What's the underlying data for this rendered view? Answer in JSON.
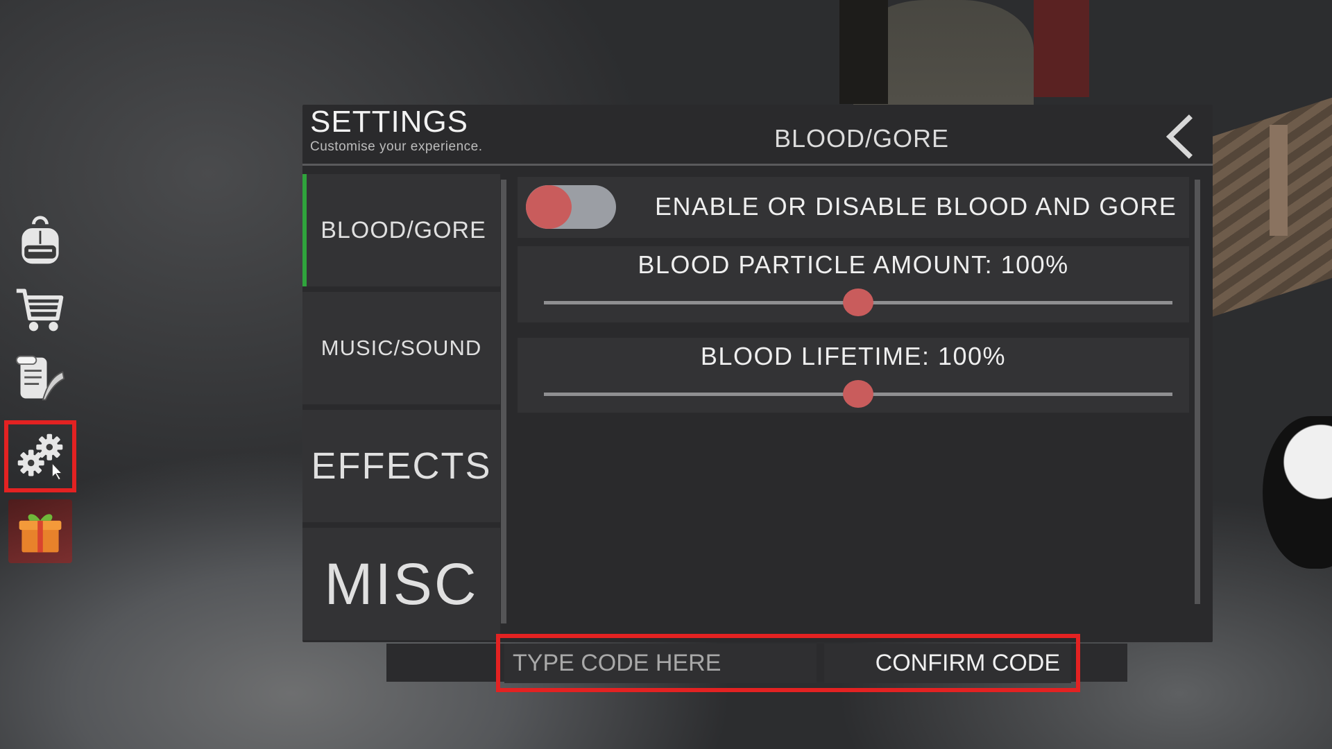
{
  "settings": {
    "title": "SETTINGS",
    "subtitle": "Customise your experience.",
    "current_section": "BLOOD/GORE",
    "back_icon": "chevron-left-icon"
  },
  "toolbar": {
    "items": [
      {
        "name": "backpack",
        "icon": "backpack-icon"
      },
      {
        "name": "shop",
        "icon": "shopping-cart-icon"
      },
      {
        "name": "quests",
        "icon": "scroll-quill-icon"
      },
      {
        "name": "settings",
        "icon": "gears-icon",
        "highlighted": true
      },
      {
        "name": "gift",
        "icon": "gift-icon"
      }
    ]
  },
  "nav": {
    "items": [
      {
        "label": "BLOOD/GORE",
        "active": true
      },
      {
        "label": "MUSIC/SOUND",
        "active": false
      },
      {
        "label": "EFFECTS",
        "active": false
      },
      {
        "label": "MISC",
        "active": false
      }
    ]
  },
  "options": {
    "toggle_label": "ENABLE OR DISABLE BLOOD AND GORE",
    "toggle_on": false,
    "particle_label": "BLOOD PARTICLE AMOUNT: 100%",
    "particle_value": 0.5,
    "lifetime_label": "BLOOD LIFETIME: 100%",
    "lifetime_value": 0.5
  },
  "code": {
    "placeholder": "TYPE CODE HERE",
    "value": "",
    "confirm_label": "CONFIRM CODE"
  },
  "colors": {
    "accent_active": "#2fa43c",
    "knob": "#c95c5c",
    "highlight": "#e32222"
  }
}
